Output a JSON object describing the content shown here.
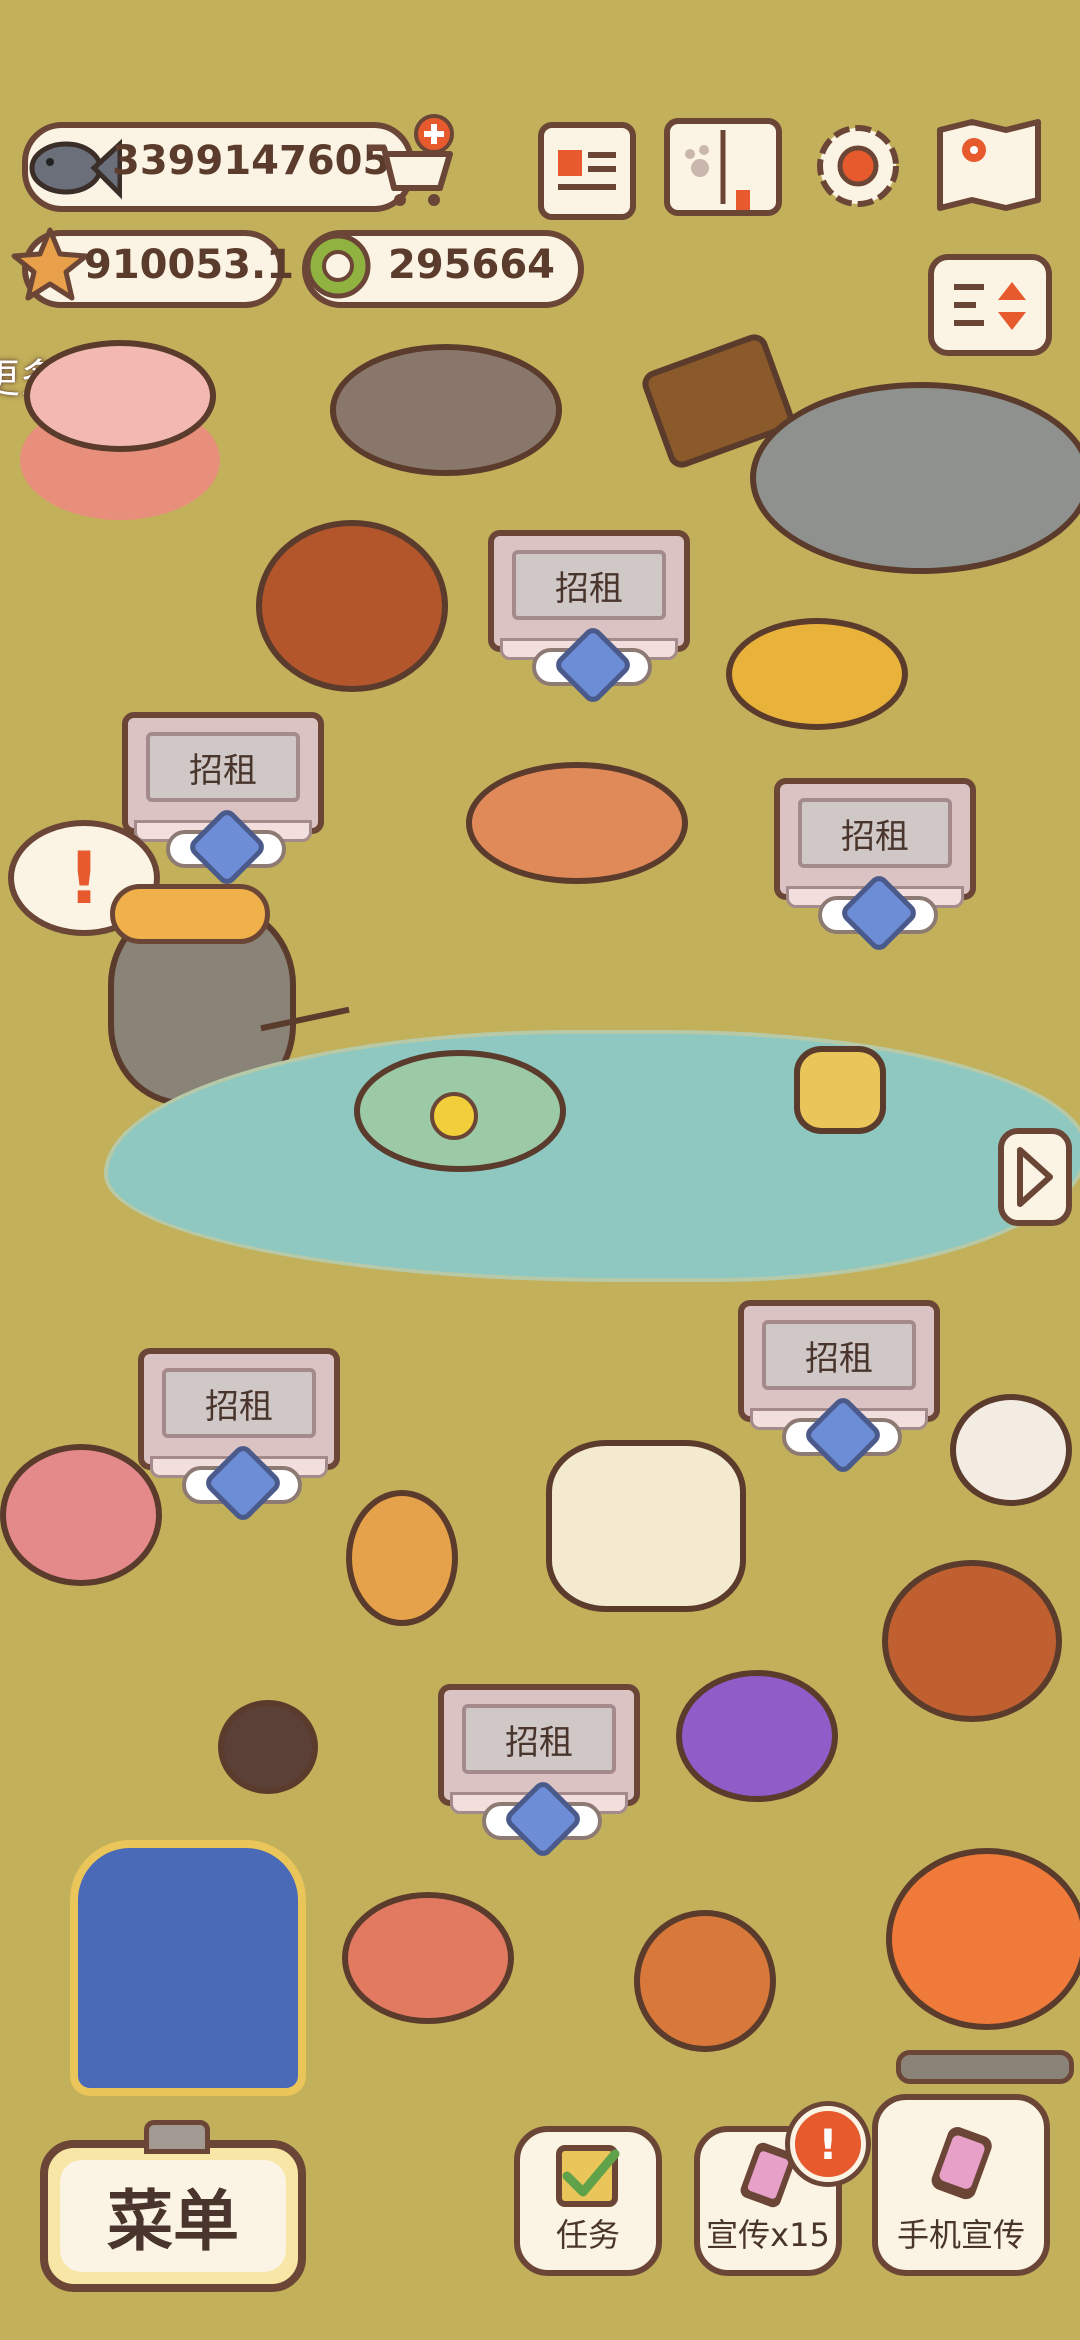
{
  "currency": {
    "fish_amount": "3399147605",
    "star_amount": "910053.1",
    "coin_amount": "295664"
  },
  "hint_text": "更多的顾客",
  "rent_label": "招租",
  "signs": [
    {
      "label": "招租"
    },
    {
      "label": "招租"
    },
    {
      "label": "招租"
    },
    {
      "label": "招租"
    },
    {
      "label": "招租"
    },
    {
      "label": "招租"
    }
  ],
  "alert_symbol": "!",
  "bottom_bar": {
    "menu_label": "菜单",
    "tasks_label": "任务",
    "promote_label": "宣传x15",
    "phone_promote_label": "手机宣传",
    "notification_symbol": "!"
  },
  "colors": {
    "ground": "#C2B05A",
    "pond": "#8EC8C0",
    "outline": "#6b4636",
    "accent_orange": "#e65a2e"
  }
}
